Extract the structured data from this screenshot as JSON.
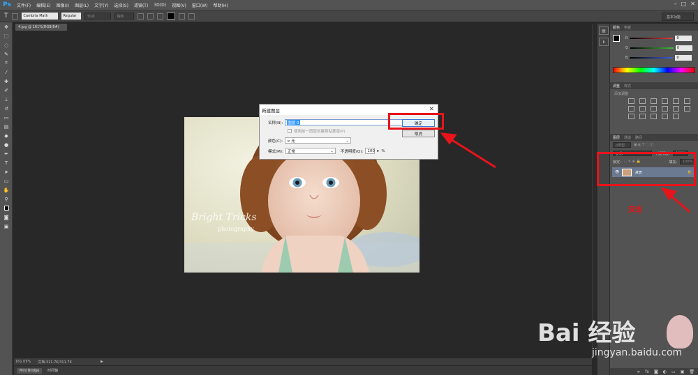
{
  "app": {
    "logo": "Ps"
  },
  "menu": [
    "文件(F)",
    "编辑(E)",
    "图像(I)",
    "图层(L)",
    "文字(Y)",
    "选择(S)",
    "滤镜(T)",
    "3D(D)",
    "视图(V)",
    "窗口(W)",
    "帮助(H)"
  ],
  "options": {
    "font_family": "Cambria Math",
    "font_style": "Regular",
    "font_size": "30点",
    "aa": "锐利",
    "workspace": "基本功能"
  },
  "document": {
    "tab_label": "4.jpg @ 161%(RGB/8#)",
    "watermark_text": "Bright Tricks",
    "watermark_sub": "photography"
  },
  "status": {
    "zoom": "161.05%",
    "doc_size": "文档:311.7K/311.7K"
  },
  "bottom_tabs": [
    "Mini Bridge",
    "时间轴"
  ],
  "color_panel": {
    "tabs": [
      "颜色",
      "色板"
    ],
    "channels": [
      {
        "label": "R",
        "value": "0",
        "color": "#e04040"
      },
      {
        "label": "G",
        "value": "0",
        "color": "#40c040"
      },
      {
        "label": "B",
        "value": "0",
        "color": "#4060e0"
      }
    ]
  },
  "adjust_panel": {
    "tabs": [
      "调整",
      "样式"
    ],
    "hint": "添加调整"
  },
  "layers_panel": {
    "tabs": [
      "图层",
      "通道",
      "路径"
    ],
    "filter_label": "ρ类型",
    "blend_mode": "正常",
    "opacity_label": "不透明度:",
    "opacity_value": "100%",
    "lock_label": "锁定:",
    "fill_label": "填充:",
    "fill_value": "100%",
    "layer_name": "背景"
  },
  "dialog": {
    "title": "新建图层",
    "name_label": "名称(N):",
    "name_value": "图层 0",
    "checkbox_label": "使用前一图层创建剪贴蒙版(P)",
    "color_label": "颜色(C):",
    "color_value": "× 无",
    "mode_label": "模式(M):",
    "mode_value": "正常",
    "opacity_label": "不透明度(O):",
    "opacity_value": "100",
    "percent": "%",
    "ok_label": "确定",
    "cancel_label": "取消",
    "close_glyph": "✕"
  },
  "annotation": {
    "text": "双击",
    "color": "#e8141b"
  },
  "watermark": {
    "brand": "Bai 经验",
    "url": "jingyan.baidu.com"
  }
}
